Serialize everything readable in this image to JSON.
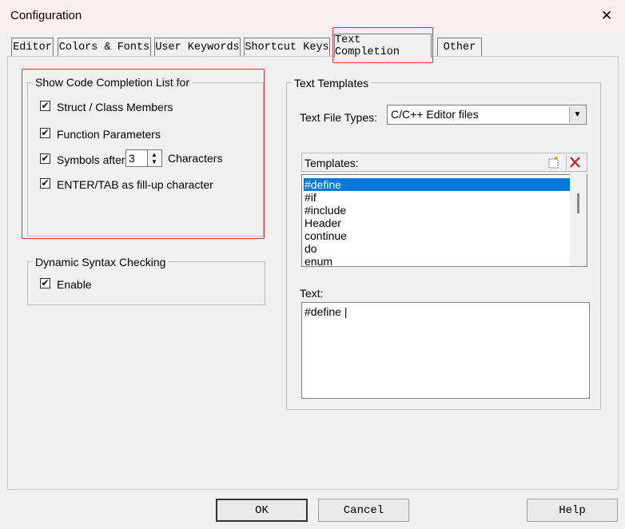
{
  "window": {
    "title": "Configuration",
    "close_glyph": "✕"
  },
  "tabs": [
    {
      "label": "Editor",
      "active": false
    },
    {
      "label": "Colors & Fonts",
      "active": false
    },
    {
      "label": "User Keywords",
      "active": false
    },
    {
      "label": "Shortcut Keys",
      "active": false
    },
    {
      "label": "Text Completion",
      "active": true
    },
    {
      "label": "Other",
      "active": false
    }
  ],
  "completion_group": {
    "title": "Show Code Completion List for",
    "struct_members": {
      "label": "Struct / Class Members",
      "checked": true
    },
    "function_params": {
      "label": "Function Parameters",
      "checked": true
    },
    "symbols_after": {
      "label": "Symbols after",
      "value": "3",
      "suffix": "Characters",
      "checked": true
    },
    "enter_tab": {
      "label": "ENTER/TAB as fill-up character",
      "checked": true
    }
  },
  "syntax_group": {
    "title": "Dynamic Syntax Checking",
    "enable": {
      "label": "Enable",
      "checked": true
    }
  },
  "templates_group": {
    "title": "Text Templates",
    "file_types_label": "Text File Types:",
    "file_types_value": "C/C++ Editor files",
    "templates_label": "Templates:",
    "templates": [
      "#define",
      "#if",
      "#include",
      "Header",
      "continue",
      "do",
      "enum"
    ],
    "selected_template": "#define",
    "text_label": "Text:",
    "text_value": "#define |"
  },
  "buttons": {
    "ok": "OK",
    "cancel": "Cancel",
    "help": "Help"
  },
  "colors": {
    "highlight": "#e0303b",
    "selection": "#0078d7",
    "title_bar": "#fbeef0"
  },
  "icons": {
    "new_template": "new-template-icon",
    "delete_template": "delete-template-icon",
    "check": "checkmark-icon"
  }
}
